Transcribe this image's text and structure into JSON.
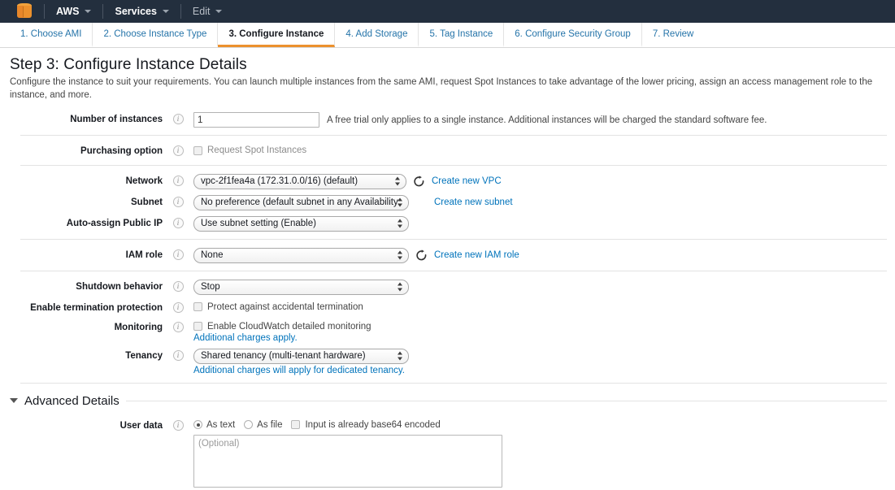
{
  "topnav": {
    "logo_name": "aws-cube-logo",
    "items": [
      {
        "label": "AWS",
        "dim": false
      },
      {
        "label": "Services",
        "dim": false
      },
      {
        "label": "Edit",
        "dim": true
      }
    ],
    "bg_color": "#232f3e",
    "accent_color": "#ec912d"
  },
  "wizard_tabs": [
    {
      "label": "1. Choose AMI",
      "active": false
    },
    {
      "label": "2. Choose Instance Type",
      "active": false
    },
    {
      "label": "3. Configure Instance",
      "active": true
    },
    {
      "label": "4. Add Storage",
      "active": false
    },
    {
      "label": "5. Tag Instance",
      "active": false
    },
    {
      "label": "6. Configure Security Group",
      "active": false
    },
    {
      "label": "7. Review",
      "active": false
    }
  ],
  "page": {
    "title": "Step 3: Configure Instance Details",
    "description": "Configure the instance to suit your requirements. You can launch multiple instances from the same AMI, request Spot Instances to take advantage of the lower pricing, assign an access management role to the instance, and more."
  },
  "form": {
    "number_of_instances": {
      "label": "Number of instances",
      "value": "1",
      "hint": "A free trial only applies to a single instance. Additional instances will be charged the standard software fee."
    },
    "purchasing_option": {
      "label": "Purchasing option",
      "checkbox_label": "Request Spot Instances",
      "checked": false
    },
    "network": {
      "label": "Network",
      "value": "vpc-2f1fea4a (172.31.0.0/16) (default)",
      "link": "Create new VPC",
      "refresh_icon": "refresh-icon"
    },
    "subnet": {
      "label": "Subnet",
      "value": "No preference (default subnet in any Availability",
      "link": "Create new subnet"
    },
    "auto_assign_public_ip": {
      "label": "Auto-assign Public IP",
      "value": "Use subnet setting (Enable)"
    },
    "iam_role": {
      "label": "IAM role",
      "value": "None",
      "link": "Create new IAM role",
      "refresh_icon": "refresh-icon"
    },
    "shutdown_behavior": {
      "label": "Shutdown behavior",
      "value": "Stop"
    },
    "termination_protection": {
      "label": "Enable termination protection",
      "checkbox_label": "Protect against accidental termination",
      "checked": false
    },
    "monitoring": {
      "label": "Monitoring",
      "checkbox_label": "Enable CloudWatch detailed monitoring",
      "checked": false,
      "sublink": "Additional charges apply."
    },
    "tenancy": {
      "label": "Tenancy",
      "value": "Shared tenancy (multi-tenant hardware)",
      "sublink": "Additional charges will apply for dedicated tenancy."
    }
  },
  "advanced": {
    "title": "Advanced Details",
    "expanded": true,
    "user_data": {
      "label": "User data",
      "radio_as_text": "As text",
      "radio_as_file": "As file",
      "checkbox_base64": "Input is already base64 encoded",
      "selected": "As text",
      "base64_checked": false,
      "textarea_placeholder": "(Optional)",
      "textarea_value": ""
    }
  }
}
